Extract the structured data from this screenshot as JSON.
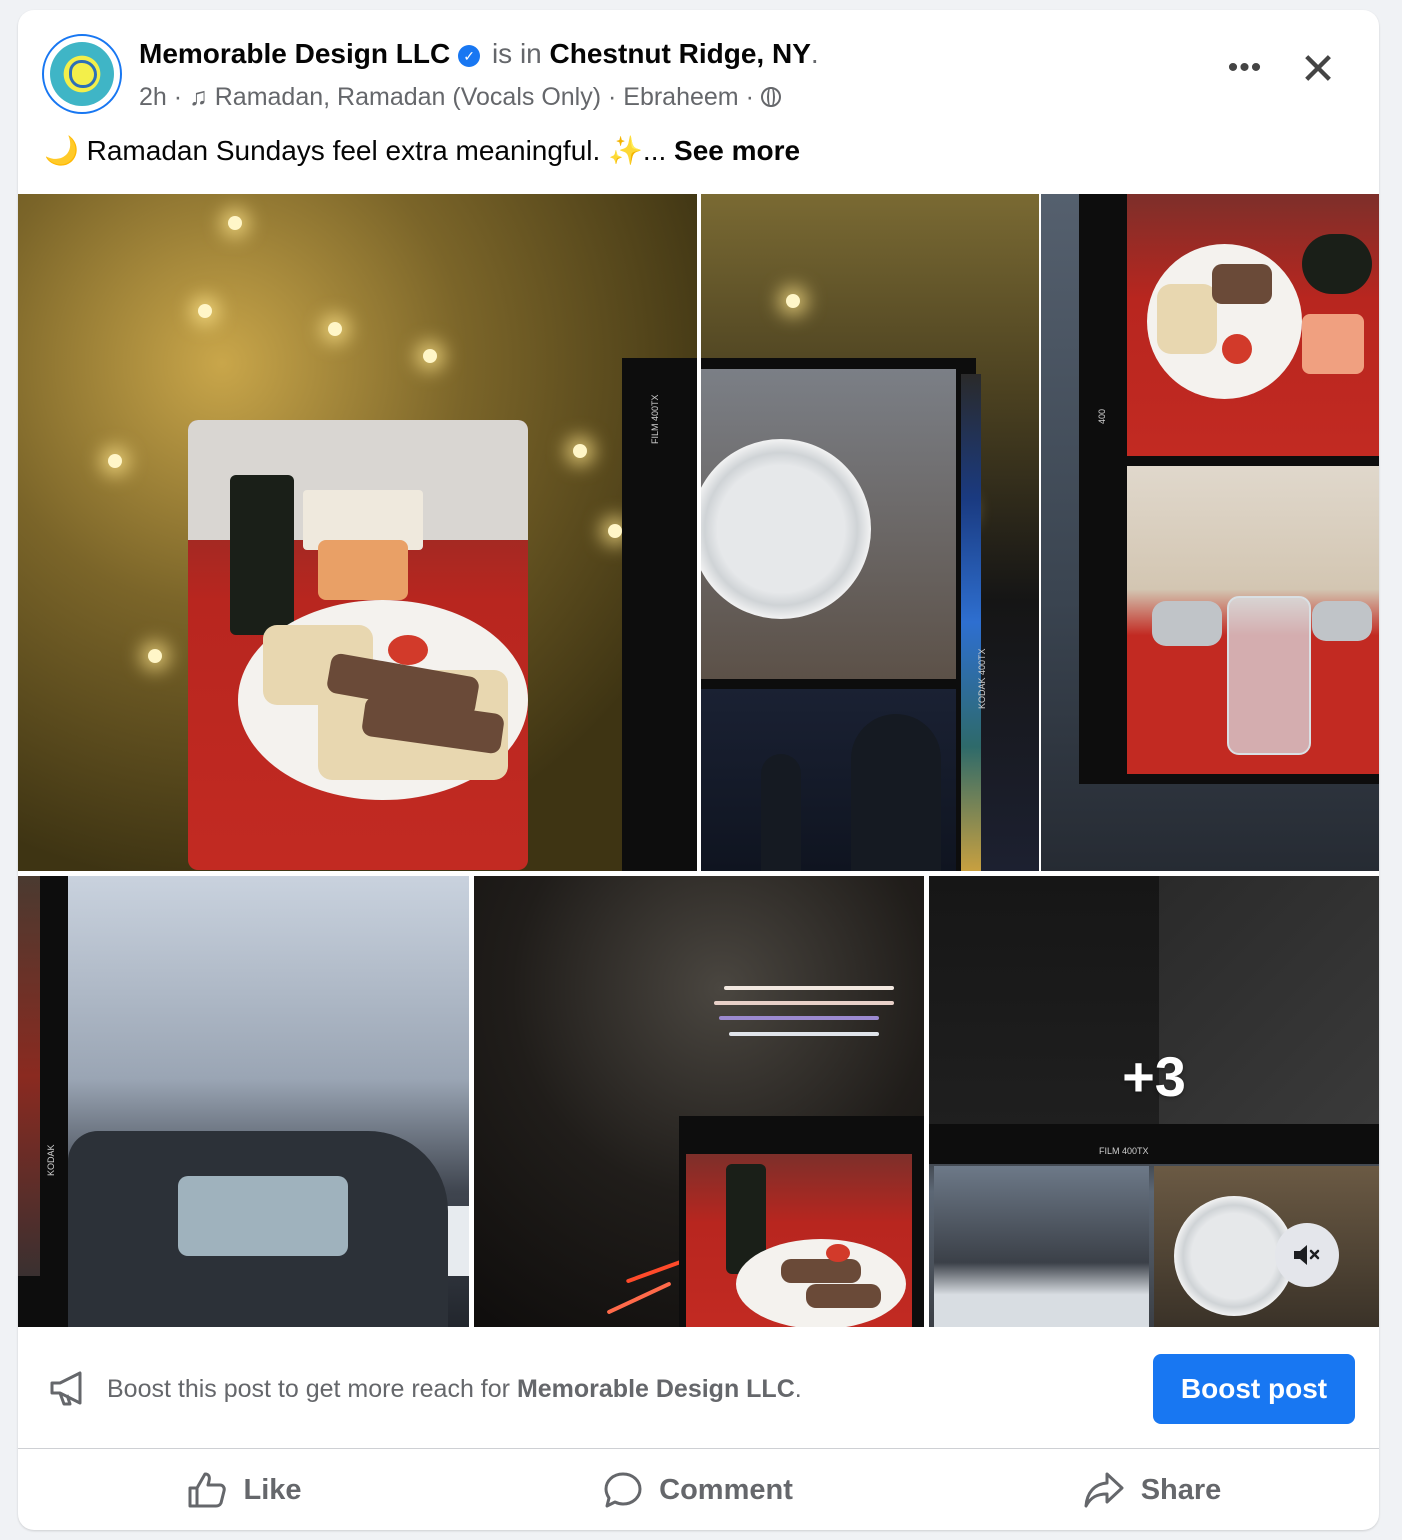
{
  "post": {
    "author": "Memorable Design LLC",
    "is_in": "is in",
    "location": "Chestnut Ridge, NY",
    "location_suffix": ".",
    "time": "2h",
    "dot": "·",
    "music": "Ramadan, Ramadan (Vocals Only)",
    "artist": "Ebraheem",
    "text": "🌙 Ramadan Sundays feel extra meaningful. ✨...",
    "see_more": "See more",
    "more_icon_label": "•••",
    "close_icon_label": "✕"
  },
  "media": {
    "extra_count": "+3",
    "film_labels": [
      "FILM 400TX",
      "KODAK 400TX",
      "400",
      "KODAK",
      "FILM 400TX"
    ],
    "mute_icon": "speaker-muted-icon"
  },
  "boost": {
    "text_prefix": "Boost this post to get more reach for",
    "page_name": "Memorable Design LLC",
    "text_suffix": ".",
    "button_label": "Boost post"
  },
  "actions": {
    "like": "Like",
    "comment": "Comment",
    "share": "Share"
  },
  "colors": {
    "accent": "#1877f2",
    "muted_text": "#65676b",
    "background": "#f0f2f5"
  }
}
